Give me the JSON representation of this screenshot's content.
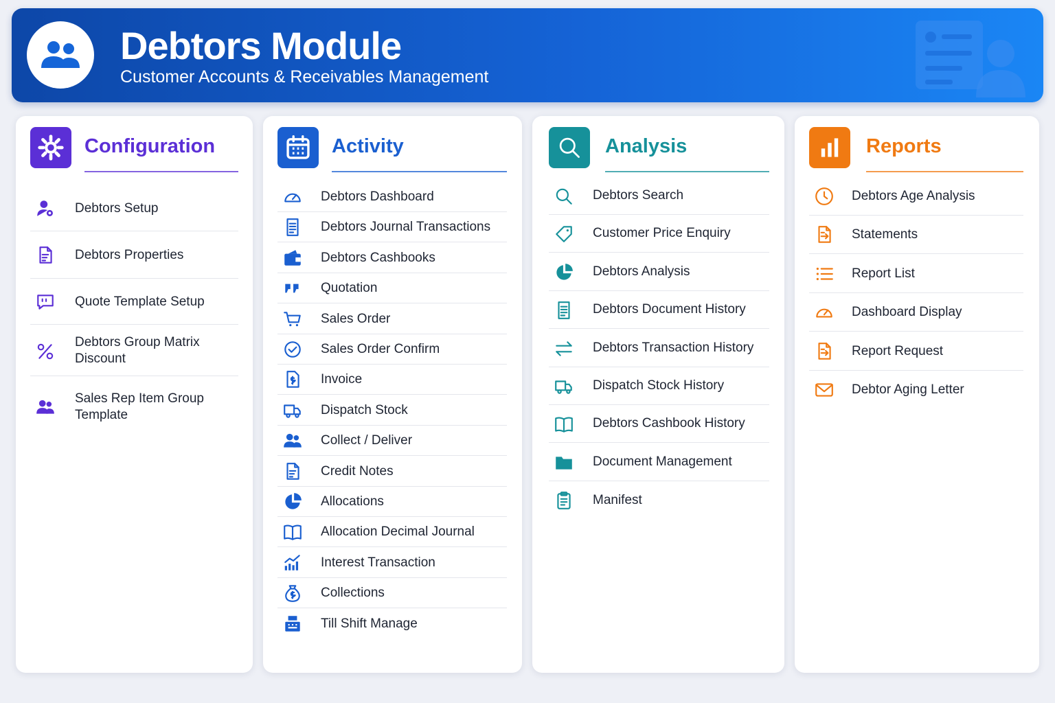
{
  "header": {
    "title": "Debtors Module",
    "subtitle": "Customer Accounts & Receivables Management",
    "logo_icon": "users-icon",
    "decoration_icon": "contact-card-icon",
    "gradient": [
      "#0d47a8",
      "#1a86f5"
    ]
  },
  "sections": [
    {
      "title": "Configuration",
      "icon": "gear-icon",
      "color": "#5b2fd6",
      "items": [
        {
          "label": "Debtors Setup",
          "icon": "user-gear-icon"
        },
        {
          "label": "Debtors Properties",
          "icon": "document-edit-icon"
        },
        {
          "label": "Quote Template Setup",
          "icon": "quote-bubble-icon"
        },
        {
          "label": "Debtors Group Matrix Discount",
          "icon": "percent-icon"
        },
        {
          "label": "Sales Rep Item Group Template",
          "icon": "users-icon"
        }
      ]
    },
    {
      "title": "Activity",
      "icon": "calendar-icon",
      "color": "#1a5fd0",
      "items": [
        {
          "label": "Debtors Dashboard",
          "icon": "speedometer-icon"
        },
        {
          "label": "Debtors Journal Transactions",
          "icon": "document-lines-icon"
        },
        {
          "label": "Debtors Cashbooks",
          "icon": "wallet-icon"
        },
        {
          "label": "Quotation",
          "icon": "quote-icon"
        },
        {
          "label": "Sales Order",
          "icon": "cart-icon"
        },
        {
          "label": "Sales Order Confirm",
          "icon": "check-circle-icon"
        },
        {
          "label": "Invoice",
          "icon": "invoice-icon"
        },
        {
          "label": "Dispatch Stock",
          "icon": "truck-icon"
        },
        {
          "label": "Collect / Deliver",
          "icon": "users-icon"
        },
        {
          "label": "Credit Notes",
          "icon": "document-edit-icon"
        },
        {
          "label": "Allocations",
          "icon": "pie-chart-icon"
        },
        {
          "label": "Allocation Decimal Journal",
          "icon": "book-icon"
        },
        {
          "label": "Interest Transaction",
          "icon": "bar-chart-trend-icon"
        },
        {
          "label": "Collections",
          "icon": "money-bag-icon"
        },
        {
          "label": "Till Shift Manage",
          "icon": "cash-register-icon"
        }
      ]
    },
    {
      "title": "Analysis",
      "icon": "search-icon",
      "color": "#16919a",
      "items": [
        {
          "label": "Debtors Search",
          "icon": "search-icon"
        },
        {
          "label": "Customer Price Enquiry",
          "icon": "tag-icon"
        },
        {
          "label": "Debtors Analysis",
          "icon": "pie-chart-icon"
        },
        {
          "label": "Debtors Document History",
          "icon": "document-lines-icon"
        },
        {
          "label": "Debtors Transaction History",
          "icon": "swap-arrows-icon"
        },
        {
          "label": "Dispatch Stock History",
          "icon": "truck-icon"
        },
        {
          "label": "Debtors Cashbook History",
          "icon": "book-icon"
        },
        {
          "label": "Document Management",
          "icon": "folder-icon"
        },
        {
          "label": "Manifest",
          "icon": "clipboard-icon"
        }
      ]
    },
    {
      "title": "Reports",
      "icon": "bar-chart-icon",
      "color": "#f07a12",
      "items": [
        {
          "label": "Debtors Age Analysis",
          "icon": "clock-icon"
        },
        {
          "label": "Statements",
          "icon": "document-export-icon"
        },
        {
          "label": "Report List",
          "icon": "list-icon"
        },
        {
          "label": "Dashboard Display",
          "icon": "speedometer-icon"
        },
        {
          "label": "Report Request",
          "icon": "document-export-icon"
        },
        {
          "label": "Debtor Aging Letter",
          "icon": "envelope-icon"
        }
      ]
    }
  ]
}
